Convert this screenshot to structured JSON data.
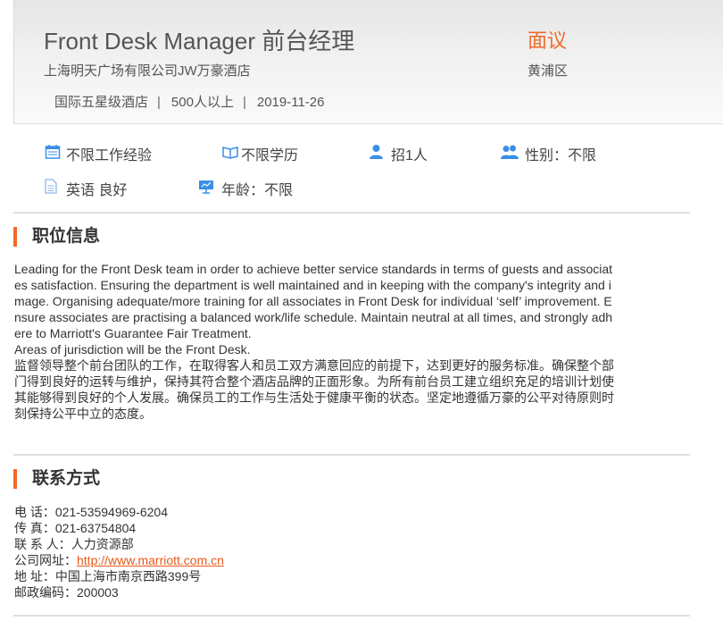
{
  "header": {
    "title": "Front Desk Manager 前台经理",
    "company": "上海明天广场有限公司JW万豪酒店",
    "meta": [
      "国际五星级酒店",
      "500人以上",
      "2019-11-26"
    ],
    "separator": "|",
    "salary": "面议",
    "district": "黄浦区"
  },
  "requirements": [
    {
      "icon": "calendar-icon",
      "text": "不限工作经验"
    },
    {
      "icon": "education-icon",
      "text": "不限学历"
    },
    {
      "icon": "person-icon",
      "text": "招1人"
    },
    {
      "icon": "people-icon",
      "text": "性别：不限"
    },
    {
      "icon": "document-icon",
      "text": "英语 良好"
    },
    {
      "icon": "presentation-icon",
      "text": "年龄：不限"
    }
  ],
  "job_info": {
    "title": "职位信息",
    "lines": [
      "Leading for the Front Desk team in order to achieve better service standards in terms of guests and associat",
      "es satisfaction. Ensuring the department is well maintained and in keeping with the company's integrity and i",
      "mage.  Organising adequate/more training for all associates in Front Desk for individual ‘self’ improvement. E",
      "nsure associates are practising a balanced work/life schedule.  Maintain neutral at all times, and strongly adh",
      "ere to Marriott's Guarantee Fair Treatment.",
      "Areas of jurisdiction will be the Front Desk.",
      "监督领导整个前台团队的工作，在取得客人和员工双方满意回应的前提下，达到更好的服务标准。确保整个部",
      "门得到良好的运转与维护，保持其符合整个酒店品牌的正面形象。为所有前台员工建立组织充足的培训计划使",
      "其能够得到良好的个人发展。确保员工的工作与生活处于健康平衡的状态。坚定地遵循万豪的公平对待原则时",
      "刻保持公平中立的态度。"
    ]
  },
  "contact": {
    "title": "联系方式",
    "phone_label": "电 话：",
    "phone": "021-53594969-6204",
    "fax_label": "传 真：",
    "fax": "021-63754804",
    "person_label": "联 系 人：",
    "person": "人力资源部",
    "website_label": "公司网址：",
    "website": "http://www.marriott.com.cn",
    "address_label": "地 址：",
    "address": "中国上海市南京西路399号",
    "postcode_label": "邮政编码：",
    "postcode": "200003"
  },
  "colors": {
    "accent": "#f06a28",
    "icon_blue": "#3a8ee6",
    "link": "#e8591a"
  }
}
